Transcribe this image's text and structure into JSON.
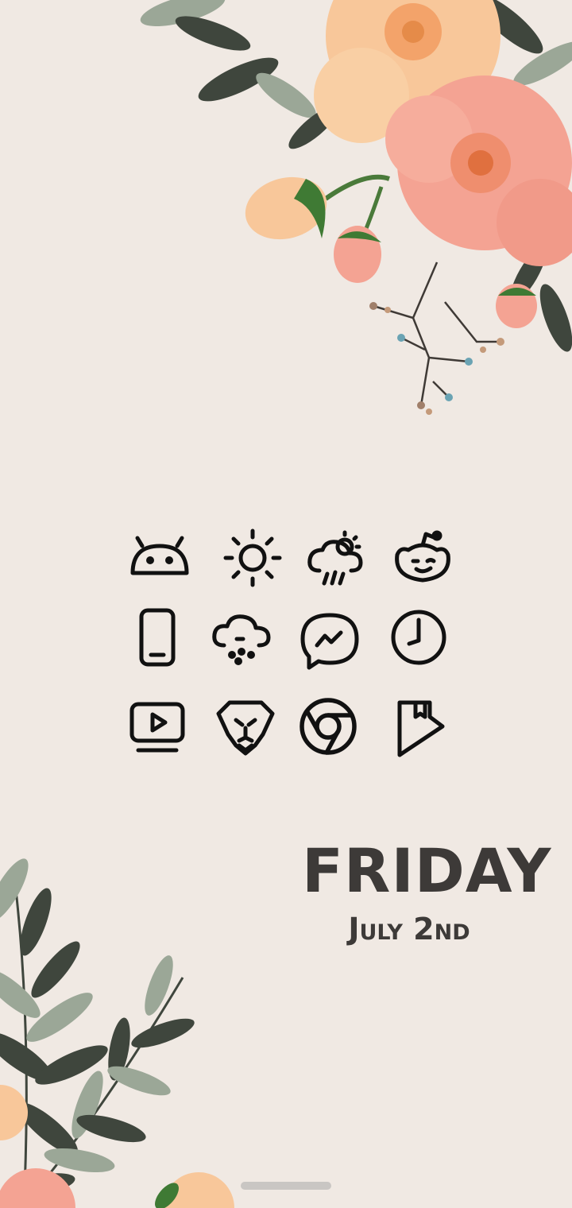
{
  "wallpaper": {
    "background": "#f0e9e3",
    "accent_pink": "#f4a393",
    "accent_peach": "#f8c79a",
    "leaf_dark": "#3f463d",
    "leaf_light": "#9ba797"
  },
  "widget": {
    "day": "FRIDAY",
    "date": "July 2nd"
  },
  "icons": [
    {
      "name": "android-icon"
    },
    {
      "name": "sun-icon"
    },
    {
      "name": "weather-icon"
    },
    {
      "name": "reddit-icon"
    },
    {
      "name": "phone-icon"
    },
    {
      "name": "cloud-rain-icon"
    },
    {
      "name": "messenger-icon"
    },
    {
      "name": "clock-icon"
    },
    {
      "name": "youtube-tv-icon"
    },
    {
      "name": "brave-lion-icon"
    },
    {
      "name": "chrome-icon"
    },
    {
      "name": "play-books-icon"
    }
  ]
}
